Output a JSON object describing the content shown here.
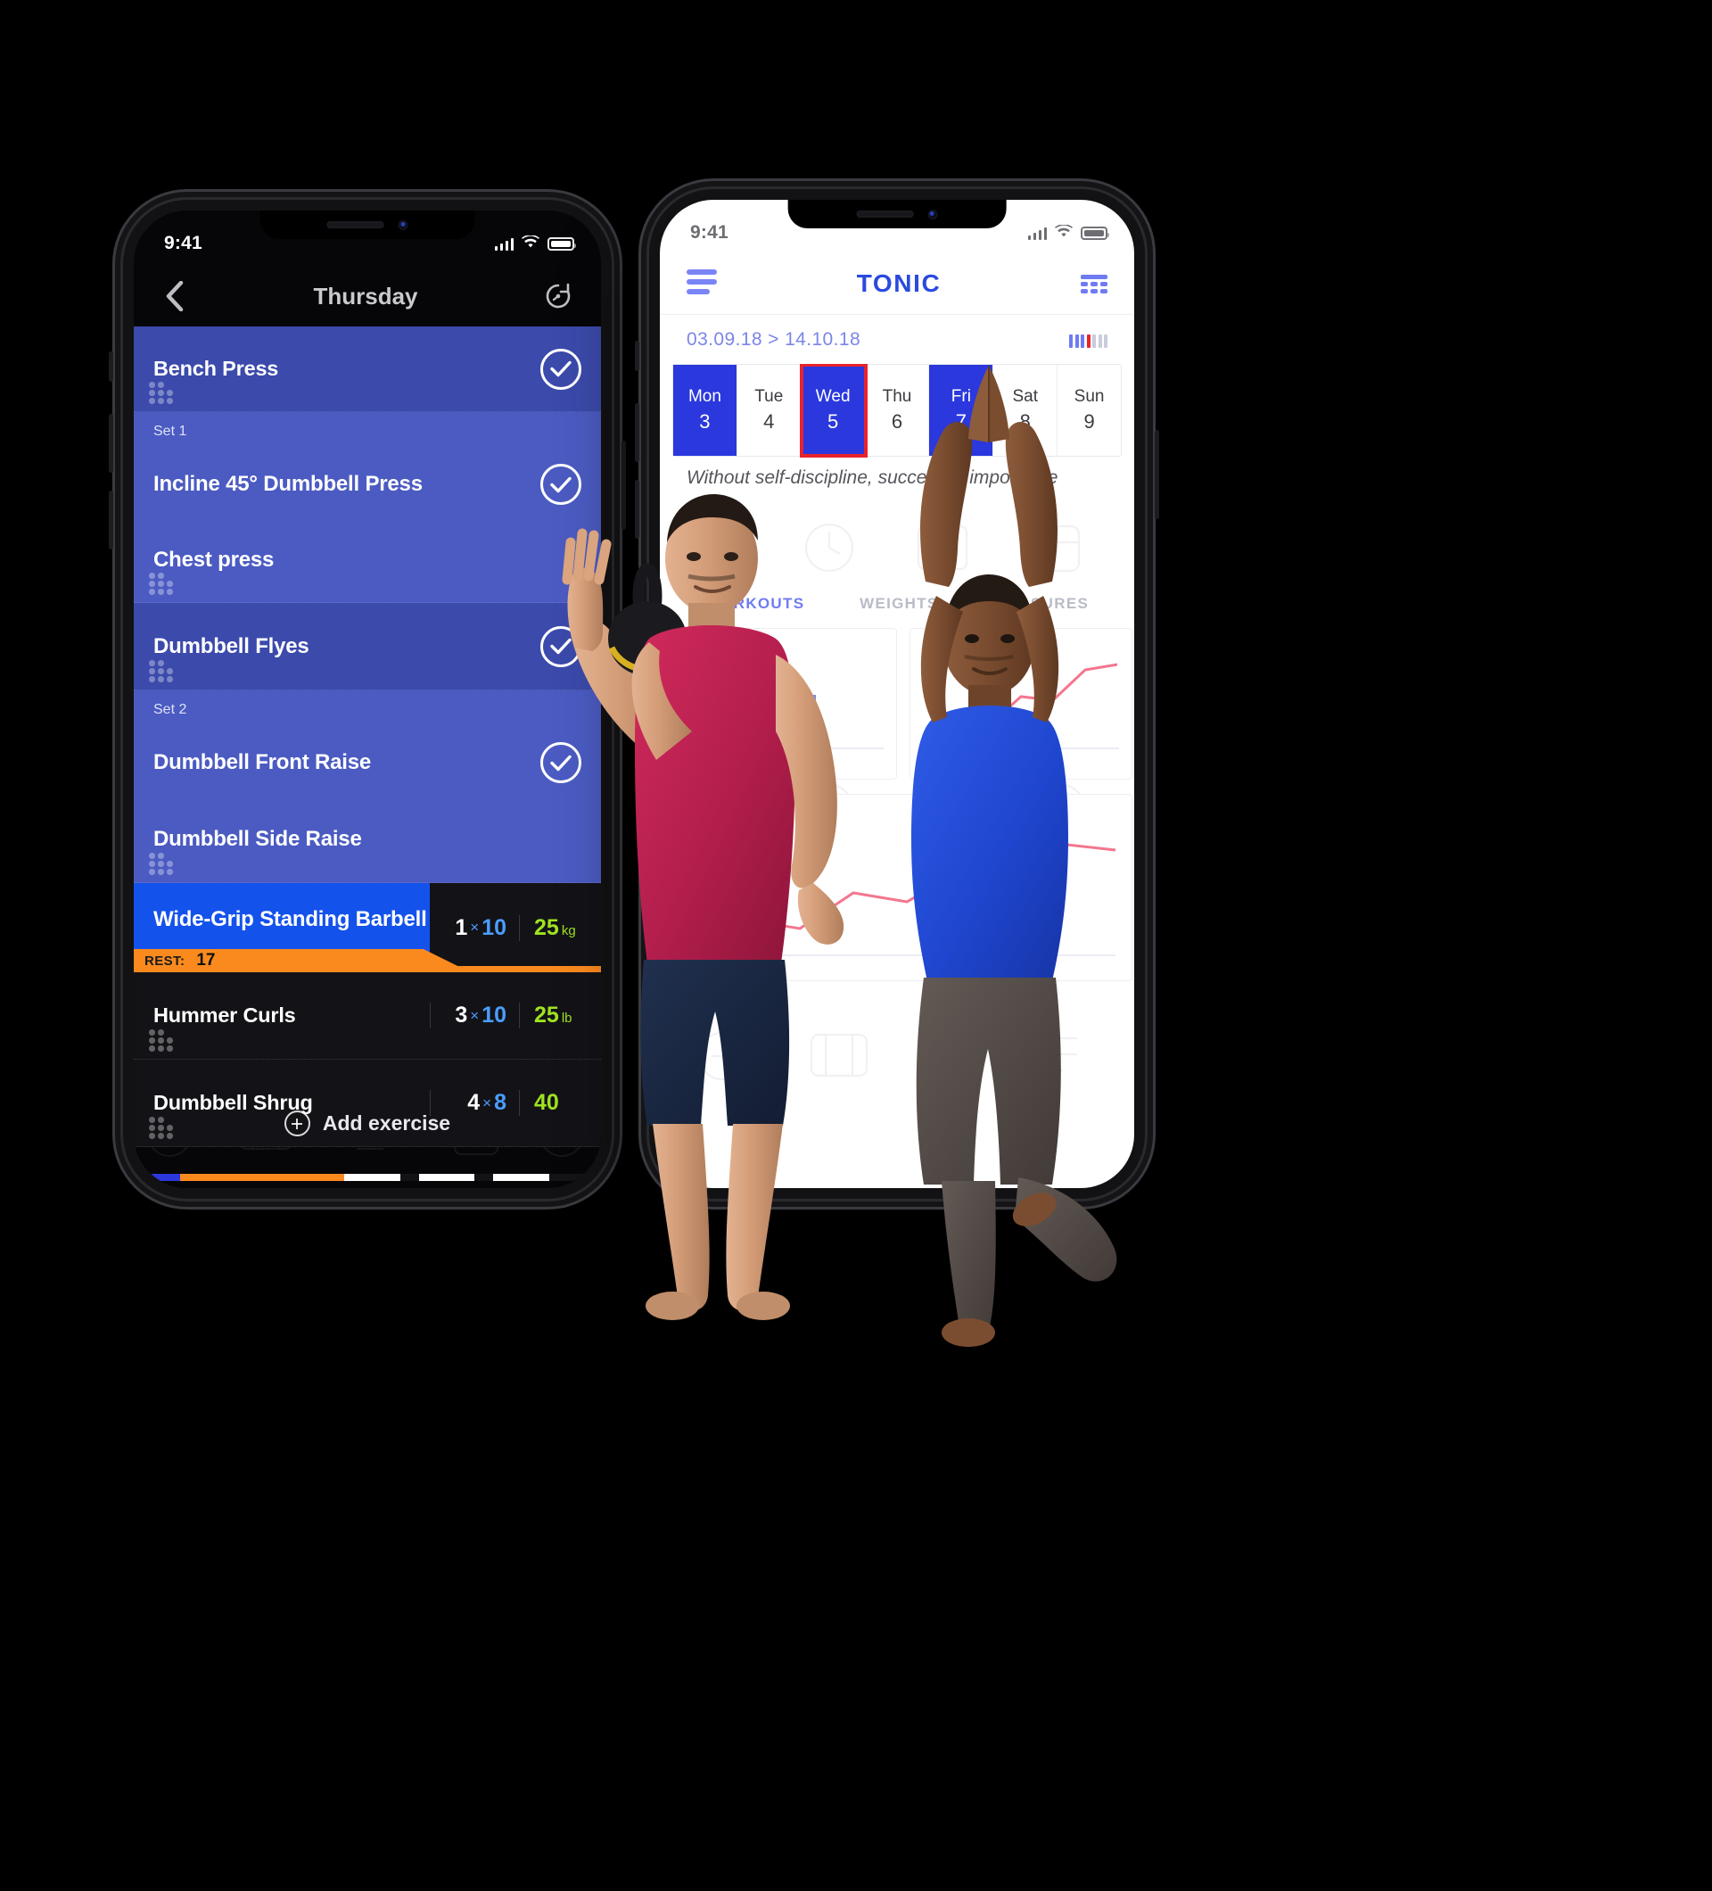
{
  "colors": {
    "accent_blue": "#2a38dd",
    "active_row_blue": "#1452ec",
    "row_blue_dark": "#3a4aa8",
    "row_blue_light": "#4a5ac0",
    "rest_orange": "#fb8a1e",
    "weight_green": "#9fe320",
    "reps_blue": "#4a9eff",
    "today_red": "#e8232a",
    "brand_indigo": "#6f7bf2",
    "dark_bg": "#131317"
  },
  "left_phone": {
    "status": {
      "time": "9:41",
      "signal_icon": "signal-bars-icon",
      "wifi_icon": "wifi-icon",
      "battery_icon": "battery-icon"
    },
    "navbar": {
      "back_icon": "chevron-left-icon",
      "title": "Thursday",
      "timer_icon": "stopwatch-icon"
    },
    "rows": [
      {
        "kind": "exercise",
        "name": "Bench Press",
        "shade": "dark",
        "checked": true,
        "handle": true
      },
      {
        "kind": "set",
        "label": "Set 1"
      },
      {
        "kind": "exercise",
        "name": "Incline 45° Dumbbell Press",
        "shade": "light",
        "checked": true,
        "handle": false
      },
      {
        "kind": "exercise",
        "name": "Chest press",
        "shade": "light",
        "checked": false,
        "handle": true
      },
      {
        "kind": "exercise",
        "name": "Dumbbell Flyes",
        "shade": "dark",
        "checked": true,
        "handle": true
      },
      {
        "kind": "set",
        "label": "Set 2"
      },
      {
        "kind": "exercise",
        "name": "Dumbbell Front Raise",
        "shade": "light",
        "checked": true,
        "handle": false
      },
      {
        "kind": "exercise",
        "name": "Dumbbell Side Raise",
        "shade": "light",
        "checked": false,
        "handle": true
      },
      {
        "kind": "active",
        "name": "Wide-Grip Standing Barbell",
        "sets": "1",
        "mult": "×",
        "reps": "10",
        "weight": "25",
        "unit": "kg",
        "rest_label": "REST:",
        "rest_value": "17"
      },
      {
        "kind": "dark",
        "name": "Hummer Curls",
        "sets": "3",
        "mult": "×",
        "reps": "10",
        "weight": "25",
        "unit": "lb",
        "handle": true
      },
      {
        "kind": "dark",
        "name": "Dumbbell Shrug",
        "sets": "4",
        "mult": "×",
        "reps": "8",
        "weight": "40",
        "unit": "",
        "handle": true
      }
    ],
    "add_button": {
      "label": "Add exercise",
      "icon": "plus-circle-icon"
    }
  },
  "right_phone": {
    "status": {
      "time": "9:41",
      "signal_icon": "signal-bars-icon",
      "wifi_icon": "wifi-icon",
      "battery_icon": "battery-icon"
    },
    "navbar": {
      "menu_icon": "hamburger-menu-icon",
      "brand": "TONIC",
      "grid_icon": "grid-view-icon"
    },
    "subbar": {
      "range": "03.09.18 > 14.10.18",
      "chart_icon": "mini-bars-icon"
    },
    "week": [
      {
        "name": "Mon",
        "num": "3",
        "state": "on"
      },
      {
        "name": "Tue",
        "num": "4",
        "state": "off"
      },
      {
        "name": "Wed",
        "num": "5",
        "state": "on",
        "today": true
      },
      {
        "name": "Thu",
        "num": "6",
        "state": "off"
      },
      {
        "name": "Fri",
        "num": "7",
        "state": "on"
      },
      {
        "name": "Sat",
        "num": "8",
        "state": "off"
      },
      {
        "name": "Sun",
        "num": "9",
        "state": "off"
      }
    ],
    "quote": "Without self-discipline, success is impossible",
    "tabs": [
      {
        "label": "WORKOUTS",
        "active": true
      },
      {
        "label": "WEIGHTS",
        "active": false
      },
      {
        "label": "MEASURES",
        "active": false
      }
    ]
  }
}
